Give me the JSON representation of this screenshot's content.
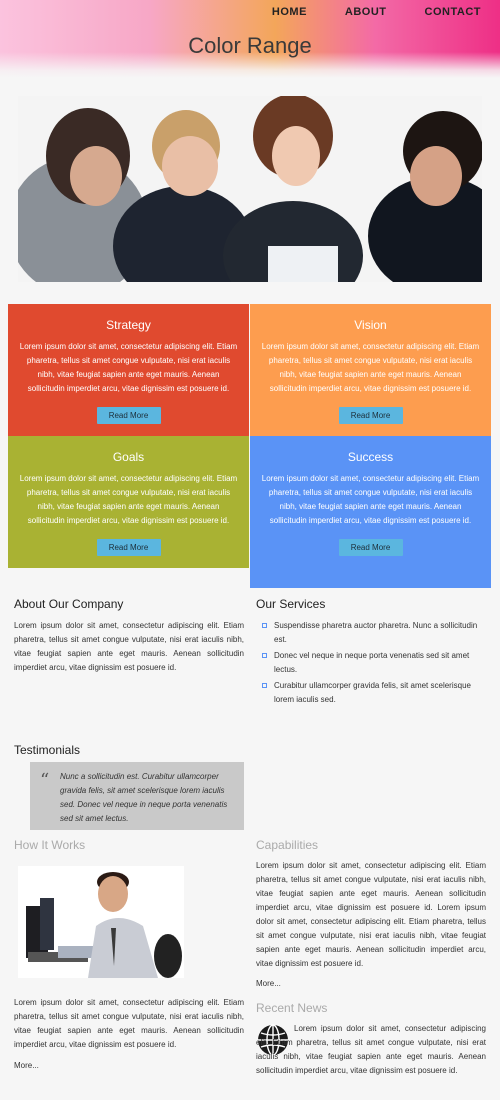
{
  "nav": {
    "items": [
      "HOME",
      "ABOUT",
      "CONTACT"
    ]
  },
  "header": {
    "title": "Color Range"
  },
  "tiles": [
    {
      "title": "Strategy",
      "text": "Lorem ipsum dolor sit amet, consectetur adipiscing elit. Etiam pharetra, tellus sit amet congue vulputate, nisi erat iaculis nibh, vitae feugiat sapien ante eget mauris. Aenean sollicitudin imperdiet arcu, vitae dignissim est posuere id.",
      "button": "Read More",
      "color": "#e04a2f"
    },
    {
      "title": "Vision",
      "text": "Lorem ipsum dolor sit amet, consectetur adipiscing elit. Etiam pharetra, tellus sit amet congue vulputate, nisi erat iaculis nibh, vitae feugiat sapien ante eget mauris. Aenean sollicitudin imperdiet arcu, vitae dignissim est posuere id.",
      "button": "Read More",
      "color": "#fd9d4f"
    },
    {
      "title": "Goals",
      "text": "Lorem ipsum dolor sit amet, consectetur adipiscing elit. Etiam pharetra, tellus sit amet congue vulputate, nisi erat iaculis nibh, vitae feugiat sapien ante eget mauris. Aenean sollicitudin imperdiet arcu, vitae dignissim est posuere id.",
      "button": "Read More",
      "color": "#a9b233"
    },
    {
      "title": "Success",
      "text": "Lorem ipsum dolor sit amet, consectetur adipiscing elit. Etiam pharetra, tellus sit amet congue vulputate, nisi erat iaculis nibh, vitae feugiat sapien ante eget mauris. Aenean sollicitudin imperdiet arcu, vitae dignissim est posuere id.",
      "button": "Read More",
      "color": "#5a93f6"
    }
  ],
  "about": {
    "title": "About Our Company",
    "text": "Lorem ipsum dolor sit amet, consectetur adipiscing elit. Etiam pharetra, tellus sit amet congue vulputate, nisi erat iaculis nibh, vitae feugiat sapien ante eget mauris. Aenean sollicitudin imperdiet arcu, vitae dignissim est posuere id."
  },
  "services": {
    "title": "Our Services",
    "items": [
      "Suspendisse pharetra auctor pharetra. Nunc a sollicitudin est.",
      "Donec vel neque in neque porta venenatis sed sit amet lectus.",
      "Curabitur ullamcorper gravida felis, sit amet scelerisque lorem iaculis sed."
    ]
  },
  "testimonials": {
    "title": "Testimonials",
    "quote": "Nunc a sollicitudin est. Curabitur ullamcorper gravida felis, sit amet scelerisque lorem iaculis sed. Donec vel neque in neque porta venenatis sed sit amet lectus."
  },
  "how_it_works": {
    "title": "How It Works",
    "text": "Lorem ipsum dolor sit amet, consectetur adipiscing elit. Etiam pharetra, tellus sit amet congue vulputate, nisi erat iaculis nibh, vitae feugiat sapien ante eget mauris. Aenean sollicitudin imperdiet arcu, vitae dignissim est posuere id.",
    "more": "More..."
  },
  "capabilities": {
    "title": "Capabilities",
    "text": "Lorem ipsum dolor sit amet, consectetur adipiscing elit. Etiam pharetra, tellus sit amet congue vulputate, nisi erat iaculis nibh, vitae feugiat sapien ante eget mauris. Aenean sollicitudin imperdiet arcu, vitae dignissim est posuere id. Lorem ipsum dolor sit amet, consectetur adipiscing elit. Etiam pharetra, tellus sit amet congue vulputate, nisi erat iaculis nibh, vitae feugiat sapien ante eget mauris. Aenean sollicitudin imperdiet arcu, vitae dignissim est posuere id.",
    "more": "More..."
  },
  "recent_news": {
    "title": "Recent News",
    "text": "Lorem ipsum dolor sit amet, consectetur adipiscing elit. Etiam pharetra, tellus sit amet congue vulputate, nisi erat iaculis nibh, vitae feugiat sapien ante eget mauris. Aenean sollicitudin imperdiet arcu, vitae dignissim est posuere id."
  },
  "icons": {
    "news": "globe-icon",
    "quote": "quote-mark-icon"
  }
}
